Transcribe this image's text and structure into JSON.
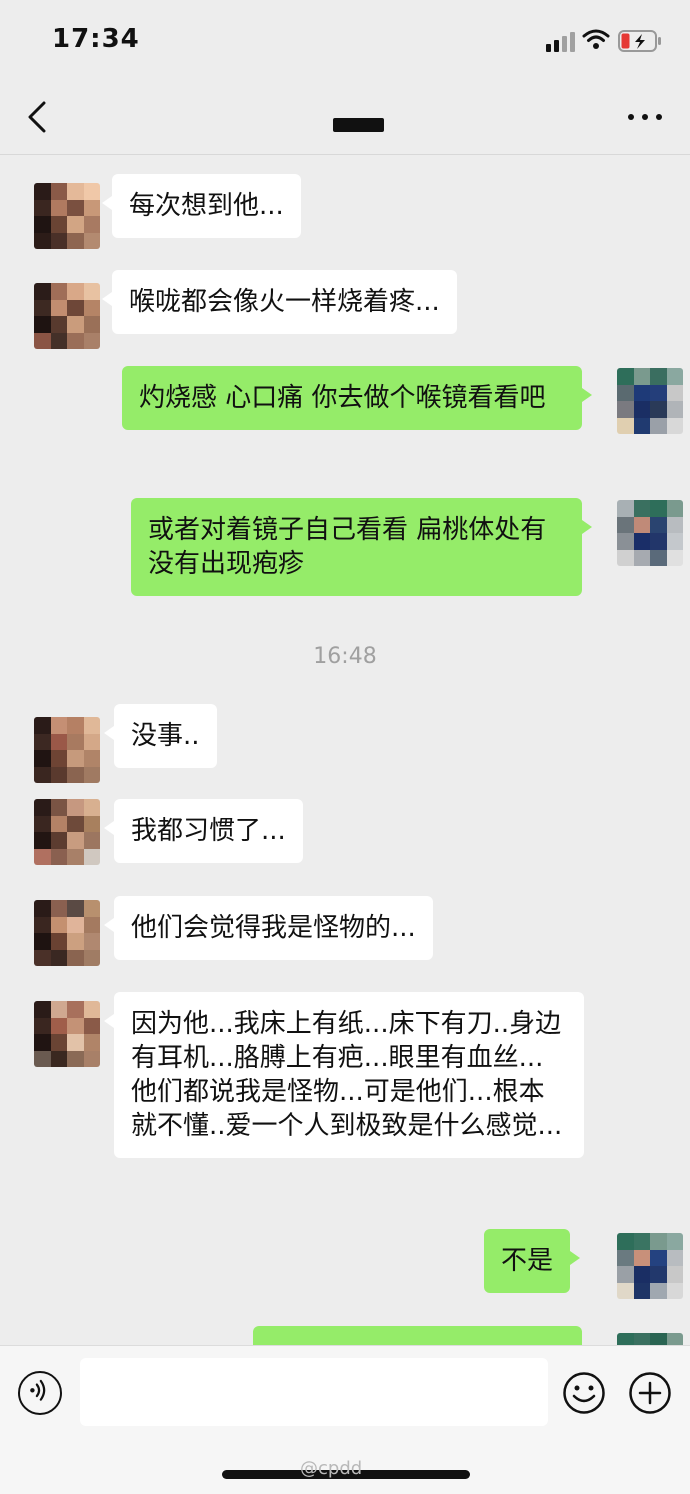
{
  "status_bar": {
    "time": "17:34"
  },
  "header": {
    "back_icon": "chevron-left-icon",
    "more_icon": "more-dots-icon"
  },
  "messages": [
    {
      "side": "in",
      "text": "每次想到他..."
    },
    {
      "side": "in",
      "text": "喉咙都会像火一样烧着疼..."
    },
    {
      "side": "out",
      "text": "灼烧感 心口痛 你去做个喉镜看看吧"
    },
    {
      "side": "out",
      "text": "或者对着镜子自己看看 扁桃体处有没有出现疱疹"
    },
    {
      "side": "in",
      "text": "没事.."
    },
    {
      "side": "in",
      "text": "我都习惯了..."
    },
    {
      "side": "in",
      "text": "他们会觉得我是怪物的..."
    },
    {
      "side": "in",
      "text": "因为他...我床上有纸...床下有刀..身边有耳机...胳膊上有疤...眼里有血丝...他们都说我是怪物...可是他们...根本就不懂..爱一个人到极致是什么感觉..."
    },
    {
      "side": "out",
      "text": "不是"
    },
    {
      "side": "out",
      "text": ""
    }
  ],
  "timestamp": "16:48",
  "input_bar": {
    "voice_icon": "voice-icon",
    "emoji_icon": "emoji-icon",
    "more_icon": "plus-icon"
  },
  "watermark": "@cpdd",
  "colors": {
    "out_bubble": "#95ec69",
    "in_bubble": "#ffffff",
    "background": "#ededed"
  }
}
